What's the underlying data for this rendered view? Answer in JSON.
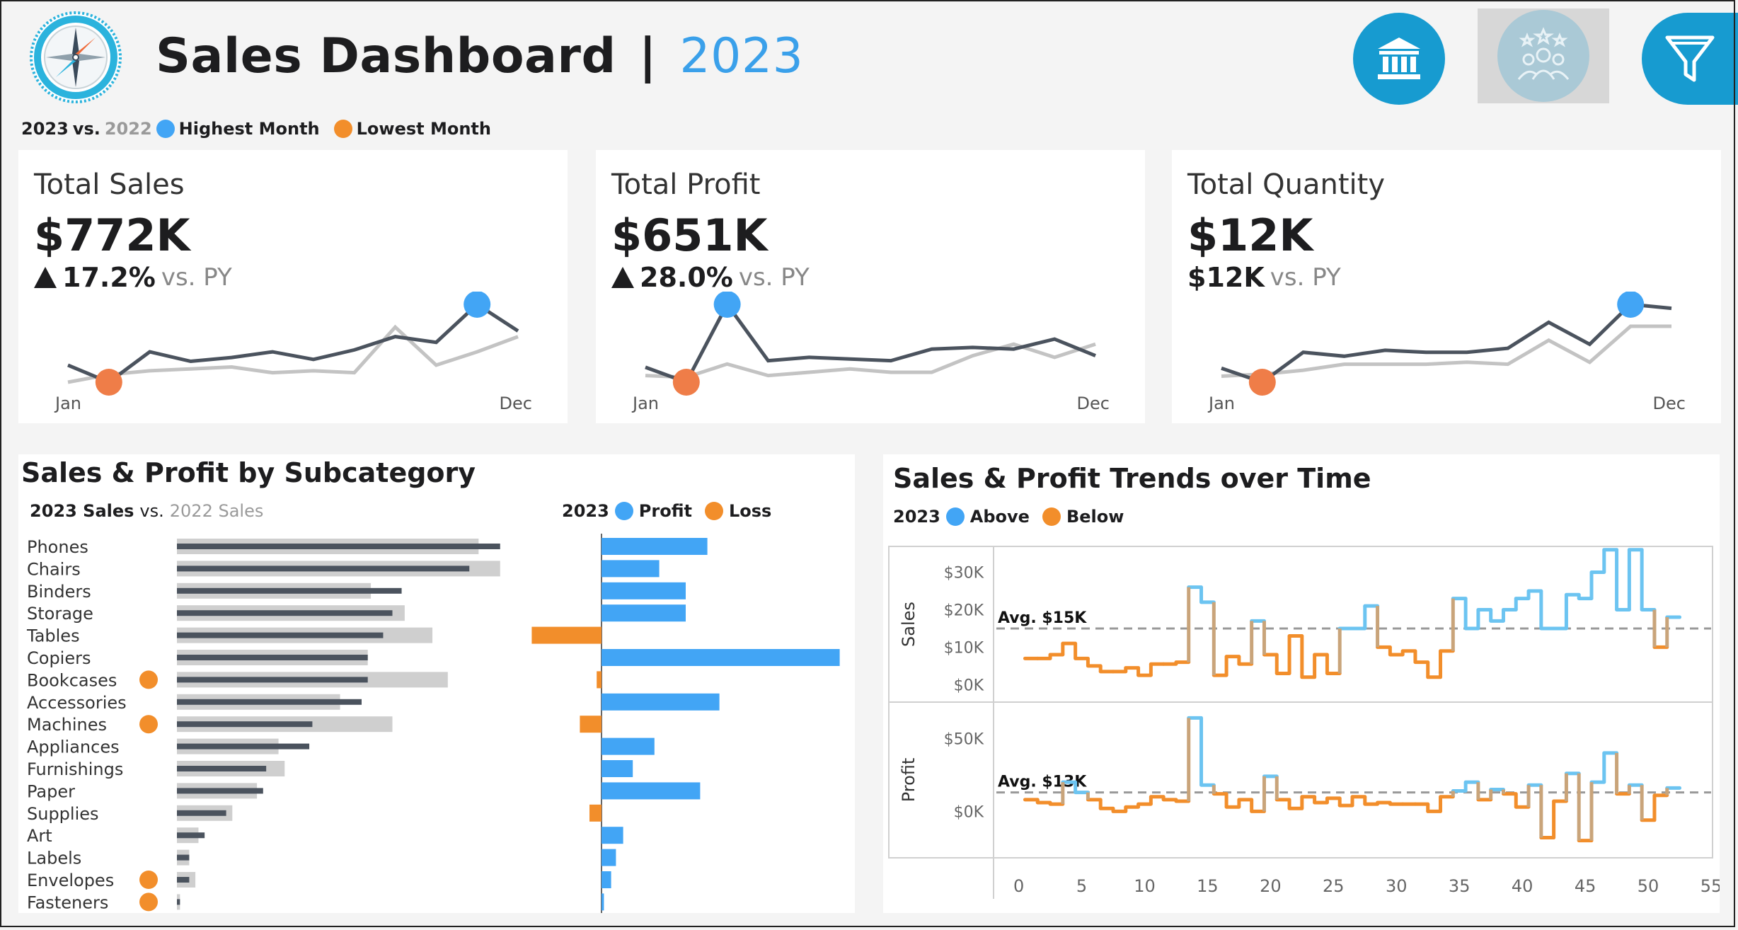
{
  "header": {
    "title": "Sales Dashboard",
    "separator": "|",
    "year": "2023",
    "buttons": [
      {
        "name": "bank-icon"
      },
      {
        "name": "users-rating-icon"
      },
      {
        "name": "filter-icon"
      }
    ]
  },
  "legend": {
    "current_year": "2023",
    "vs": "vs.",
    "prior_year": "2022",
    "highest": "Highest Month",
    "lowest": "Lowest Month"
  },
  "colors": {
    "accent": "#3aa0ea",
    "highest": "#42a5f5",
    "lowest": "#f28e2b",
    "current_line": "#4b535e",
    "prior_line": "#c3c3c3",
    "profit_bar": "#42a5f5",
    "loss_bar": "#f28e2b"
  },
  "kpis": [
    {
      "label": "Total Sales",
      "value": "$772K",
      "change": "17.2%",
      "change_arrow": "up",
      "vs": "vs. PY",
      "axis_start": "Jan",
      "axis_end": "Dec",
      "current": [
        40,
        31,
        47,
        42,
        44,
        47,
        43,
        48,
        55,
        52,
        72,
        58
      ],
      "prior": [
        31,
        35,
        37,
        38,
        39,
        36,
        37,
        36,
        60,
        40,
        47,
        55
      ],
      "min_index": 1,
      "max_index": 10
    },
    {
      "label": "Total Profit",
      "value": "$651K",
      "change": "28.0%",
      "change_arrow": "up",
      "vs": "vs. PY",
      "axis_start": "Jan",
      "axis_end": "Dec",
      "current": [
        40,
        31,
        78,
        44,
        46,
        45,
        44,
        51,
        52,
        51,
        57,
        47
      ],
      "prior": [
        35,
        34,
        42,
        35,
        37,
        39,
        37,
        37,
        47,
        54,
        46,
        54
      ],
      "min_index": 1,
      "max_index": 2
    },
    {
      "label": "Total Quantity",
      "value": "$12K",
      "change": "$12K",
      "change_arrow": "none",
      "vs": "vs. PY",
      "axis_start": "Jan",
      "axis_end": "Dec",
      "current": [
        38,
        31,
        46,
        44,
        47,
        46,
        46,
        48,
        61,
        50,
        70,
        68
      ],
      "prior": [
        34,
        35,
        37,
        40,
        40,
        40,
        41,
        40,
        52,
        41,
        59,
        59
      ],
      "min_index": 1,
      "max_index": 10
    }
  ],
  "subcategory": {
    "title": "Sales & Profit by Subcategory",
    "sales_legend": {
      "current": "2023 Sales",
      "vs": "vs.",
      "prior": "2022 Sales"
    },
    "profit_legend": {
      "year": "2023",
      "profit": "Profit",
      "loss": "Loss"
    }
  },
  "trends": {
    "title": "Sales & Profit Trends over Time",
    "legend": {
      "year": "2023",
      "above": "Above",
      "below": "Below"
    }
  },
  "chart_data": [
    {
      "type": "bar",
      "title": "Sales & Profit by Subcategory",
      "categories": [
        "Phones",
        "Chairs",
        "Binders",
        "Storage",
        "Tables",
        "Copiers",
        "Bookcases",
        "Accessories",
        "Machines",
        "Appliances",
        "Furnishings",
        "Paper",
        "Supplies",
        "Art",
        "Labels",
        "Envelopes",
        "Fasteners"
      ],
      "series": [
        {
          "name": "2023 Sales",
          "values": [
            105,
            95,
            73,
            70,
            67,
            62,
            62,
            60,
            44,
            43,
            29,
            28,
            16,
            9,
            4,
            4,
            1
          ]
        },
        {
          "name": "2022 Sales",
          "values": [
            98,
            105,
            63,
            74,
            83,
            62,
            88,
            53,
            70,
            33,
            35,
            26,
            18,
            7,
            4,
            6,
            1
          ]
        },
        {
          "name": "Profit",
          "values": [
            44,
            24,
            35,
            35,
            -29,
            99,
            -2,
            49,
            -9,
            22,
            13,
            41,
            -5,
            9,
            6,
            4,
            1
          ]
        }
      ],
      "low_flags": [
        "Bookcases",
        "Machines",
        "Envelopes",
        "Fasteners"
      ]
    },
    {
      "type": "line",
      "title": "Sales & Profit Trends over Time",
      "x": [
        1,
        2,
        3,
        4,
        5,
        6,
        7,
        8,
        9,
        10,
        11,
        12,
        13,
        14,
        15,
        16,
        17,
        18,
        19,
        20,
        21,
        22,
        23,
        24,
        25,
        26,
        27,
        28,
        29,
        30,
        31,
        32,
        33,
        34,
        35,
        36,
        37,
        38,
        39,
        40,
        41,
        42,
        43,
        44,
        45,
        46,
        47,
        48,
        49,
        50,
        51,
        52
      ],
      "xlim": [
        -2,
        55
      ],
      "xticks": [
        0,
        5,
        10,
        15,
        20,
        25,
        30,
        35,
        40,
        45,
        50,
        55
      ],
      "panels": [
        {
          "ylabel": "Sales",
          "ylim": [
            -2000,
            35000
          ],
          "yticks": [
            {
              "v": 0,
              "label": "$0K"
            },
            {
              "v": 10000,
              "label": "$10K"
            },
            {
              "v": 20000,
              "label": "$20K"
            },
            {
              "v": 30000,
              "label": "$30K"
            }
          ],
          "avg": 15000,
          "avg_label": "Avg. $15K",
          "values": [
            7000,
            7000,
            8000,
            11000,
            7000,
            5000,
            3500,
            3500,
            4500,
            2500,
            5500,
            5500,
            6000,
            26000,
            22000,
            2500,
            7500,
            5500,
            17000,
            8000,
            3000,
            13000,
            2000,
            8000,
            3000,
            15000,
            15000,
            21000,
            10000,
            8000,
            9000,
            6000,
            2000,
            9000,
            23000,
            15000,
            20000,
            17000,
            20000,
            23000,
            25000,
            15000,
            15000,
            24000,
            23000,
            30000,
            36000,
            20000,
            36000,
            20000,
            10000,
            18000
          ]
        },
        {
          "ylabel": "Profit",
          "ylim": [
            -25000,
            70000
          ],
          "yticks": [
            {
              "v": 0,
              "label": "$0K"
            },
            {
              "v": 50000,
              "label": "$50K"
            }
          ],
          "avg": 13000,
          "avg_label": "Avg. $13K",
          "values": [
            8000,
            6000,
            5000,
            20000,
            13000,
            8000,
            2000,
            0,
            3000,
            5000,
            10000,
            8000,
            7000,
            64000,
            18000,
            12000,
            3000,
            8000,
            0,
            24000,
            8000,
            2000,
            10000,
            6000,
            9000,
            4000,
            10000,
            5000,
            6000,
            5000,
            5000,
            5000,
            0,
            10000,
            14000,
            20000,
            8000,
            15000,
            12000,
            3000,
            18000,
            -18000,
            7000,
            26000,
            -20000,
            20000,
            40000,
            12000,
            18000,
            -6000,
            11000,
            16000
          ]
        }
      ]
    }
  ]
}
